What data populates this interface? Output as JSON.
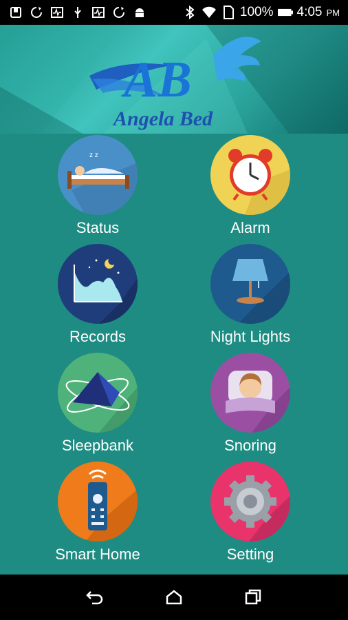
{
  "status_bar": {
    "battery": "100%",
    "time": "4:05",
    "ampm": "PM",
    "icons": [
      "sim-icon",
      "sync-icon",
      "pulse-icon",
      "usb-icon",
      "pulse-icon",
      "sync-icon",
      "android-icon",
      "bluetooth-icon",
      "wifi-icon",
      "sd-card-icon",
      "battery-icon"
    ]
  },
  "banner": {
    "logo_text": "AB",
    "brand": "Angela Bed"
  },
  "menu": {
    "status": "Status",
    "alarm": "Alarm",
    "records": "Records",
    "night_lights": "Night Lights",
    "sleepbank": "Sleepbank",
    "snoring": "Snoring",
    "smart_home": "Smart Home",
    "setting": "Setting"
  },
  "navbar": {
    "icons": [
      "back-icon",
      "home-icon",
      "recents-icon"
    ]
  },
  "colors": {
    "background": "#1e8c82",
    "status_circle": "#4a90c8",
    "alarm_circle": "#f0d354",
    "records_circle": "#1f3d7a",
    "night_lights_circle": "#1f5a8e",
    "sleepbank_circle": "#4fb27a",
    "snoring_circle": "#9b4fa3",
    "smart_home_circle": "#f07b1a",
    "setting_circle": "#e8336b"
  }
}
